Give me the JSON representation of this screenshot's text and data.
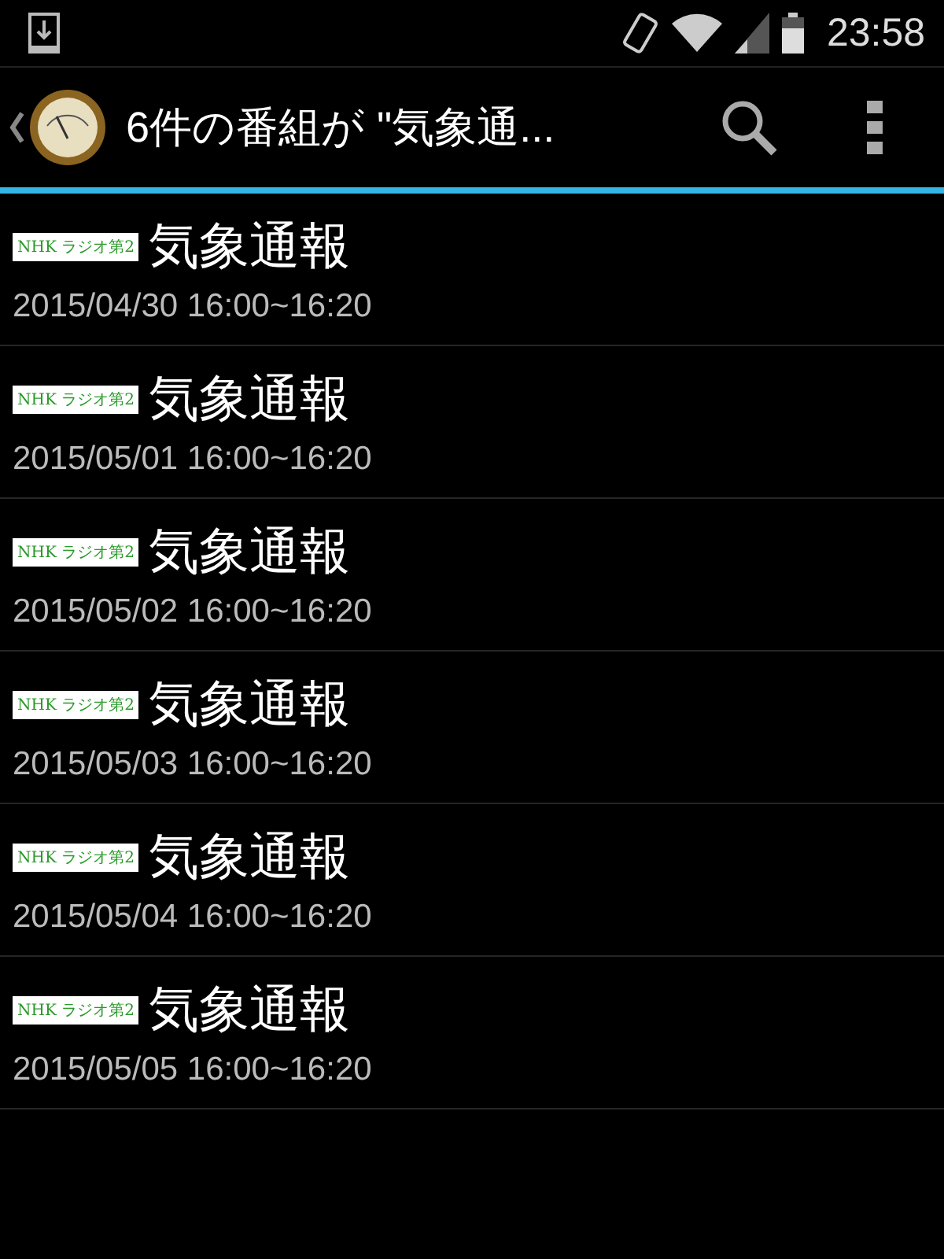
{
  "status_bar": {
    "time": "23:58"
  },
  "action_bar": {
    "title": "6件の番組が \"気象通..."
  },
  "programs": [
    {
      "station": "NHK ラジオ第2",
      "title": "気象通報",
      "schedule": "2015/04/30 16:00~16:20"
    },
    {
      "station": "NHK ラジオ第2",
      "title": "気象通報",
      "schedule": "2015/05/01 16:00~16:20"
    },
    {
      "station": "NHK ラジオ第2",
      "title": "気象通報",
      "schedule": "2015/05/02 16:00~16:20"
    },
    {
      "station": "NHK ラジオ第2",
      "title": "気象通報",
      "schedule": "2015/05/03 16:00~16:20"
    },
    {
      "station": "NHK ラジオ第2",
      "title": "気象通報",
      "schedule": "2015/05/04 16:00~16:20"
    },
    {
      "station": "NHK ラジオ第2",
      "title": "気象通報",
      "schedule": "2015/05/05 16:00~16:20"
    }
  ]
}
